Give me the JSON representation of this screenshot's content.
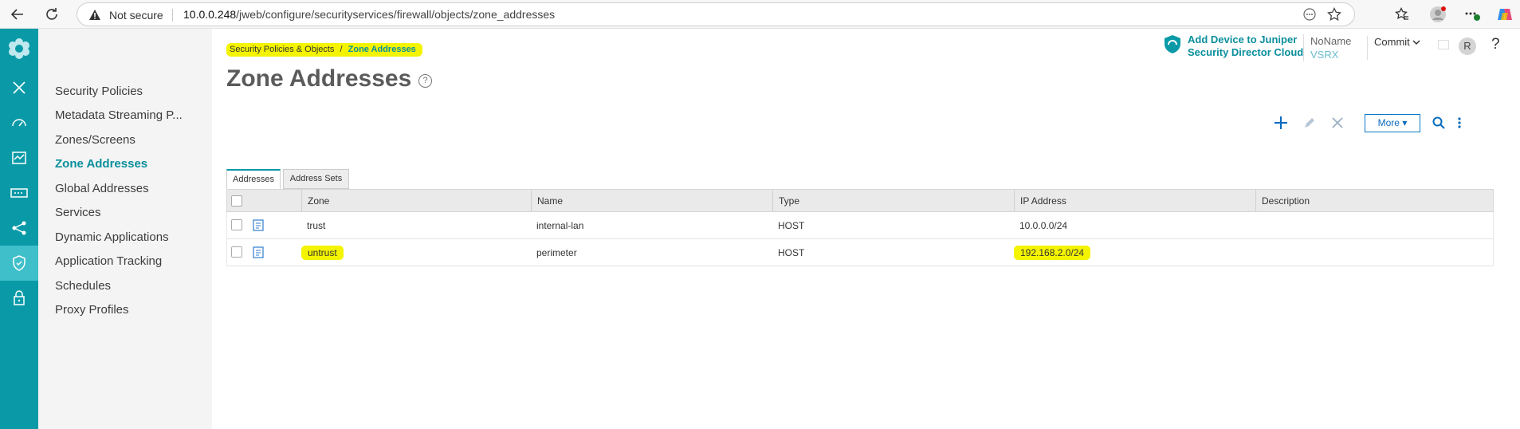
{
  "browser": {
    "security_text": "Not secure",
    "url_host": "10.0.0.248",
    "url_path": "/jweb/configure/securityservices/firewall/objects/zone_addresses"
  },
  "submenu": {
    "items": [
      {
        "label": "Security Policies",
        "active": false
      },
      {
        "label": "Metadata Streaming P...",
        "active": false
      },
      {
        "label": "Zones/Screens",
        "active": false
      },
      {
        "label": "Zone Addresses",
        "active": true
      },
      {
        "label": "Global Addresses",
        "active": false
      },
      {
        "label": "Services",
        "active": false
      },
      {
        "label": "Dynamic Applications",
        "active": false
      },
      {
        "label": "Application Tracking",
        "active": false
      },
      {
        "label": "Schedules",
        "active": false
      },
      {
        "label": "Proxy Profiles",
        "active": false
      }
    ]
  },
  "breadcrumb": {
    "parent": "Security Policies & Objects",
    "separator": "/",
    "current": "Zone Addresses"
  },
  "page": {
    "title": "Zone Addresses",
    "help": "?"
  },
  "header": {
    "add_device_line1": "Add Device to Juniper",
    "add_device_line2": "Security Director Cloud",
    "device_name": "NoName",
    "device_model": "VSRX",
    "commit_label": "Commit",
    "user_initial": "R",
    "help_label": "?"
  },
  "toolbar": {
    "more_label": "More"
  },
  "tabs": [
    {
      "label": "Addresses",
      "active": true
    },
    {
      "label": "Address Sets",
      "active": false
    }
  ],
  "grid": {
    "columns": [
      "Zone",
      "Name",
      "Type",
      "IP Address",
      "Description"
    ],
    "rows": [
      {
        "zone": "trust",
        "name": "internal-lan",
        "type": "HOST",
        "ip": "10.0.0.0/24",
        "description": ""
      },
      {
        "zone": "untrust",
        "name": "perimeter",
        "type": "HOST",
        "ip": "192.168.2.0/24",
        "description": ""
      }
    ]
  },
  "colors": {
    "accent": "#0a9aa7",
    "highlight": "#f4f400",
    "rail_active": "#3fbfca"
  }
}
